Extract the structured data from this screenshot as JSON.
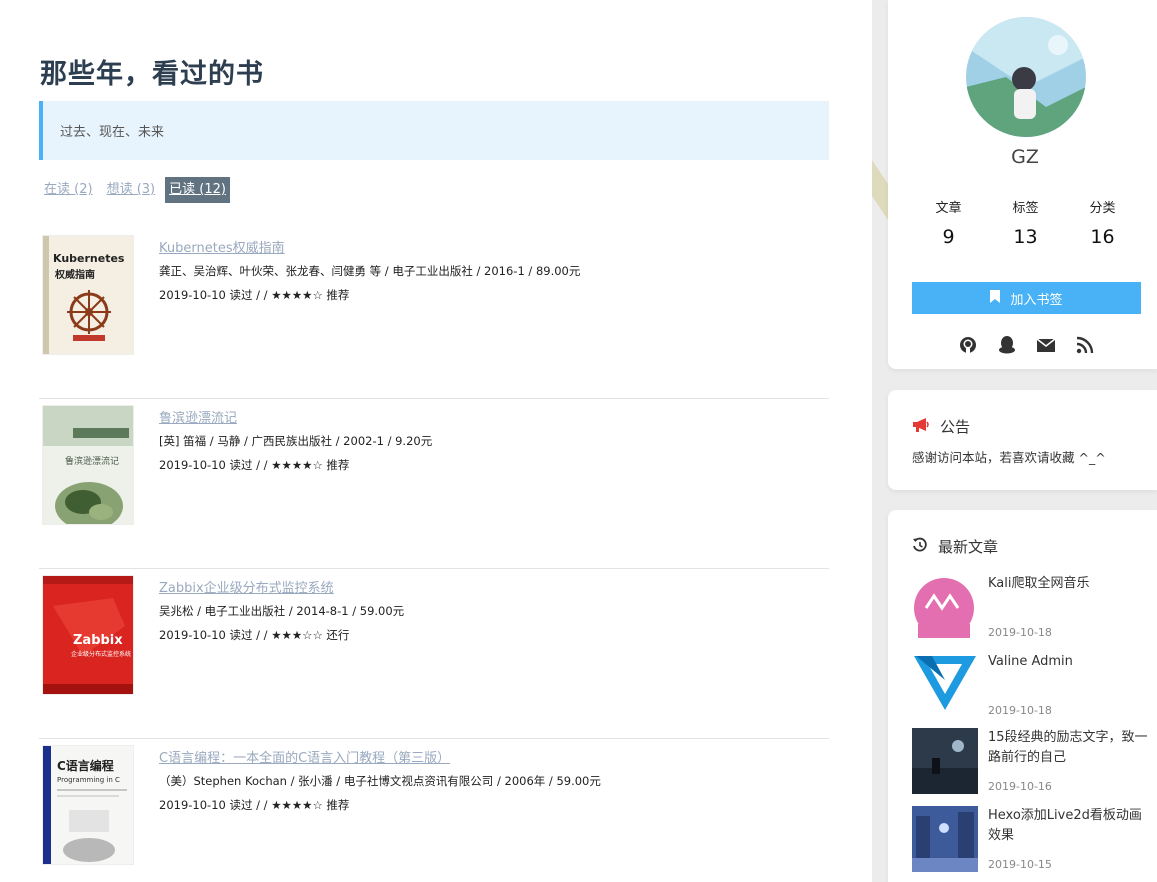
{
  "page": {
    "title": "那些年，看过的书",
    "quote": "过去、现在、未来"
  },
  "tabs": [
    {
      "label": "在读 (2)"
    },
    {
      "label": "想读 (3)"
    },
    {
      "label": "已读 (12)"
    }
  ],
  "books": [
    {
      "title": "Kubernetes权威指南",
      "meta": "龚正、吴治辉、叶伙荣、张龙春、闫健勇 等 / 电子工业出版社 / 2016-1 / 89.00元",
      "read": "2019-10-10 读过 / / ★★★★☆ 推荐",
      "cover_text": "Kubernetes",
      "cover_sub": "权威指南"
    },
    {
      "title": "鲁滨逊漂流记",
      "meta": "[英] 笛福 / 马静 / 广西民族出版社 / 2002-1 / 9.20元",
      "read": "2019-10-10 读过 / / ★★★★☆ 推荐",
      "cover_text": "鲁滨逊漂流记"
    },
    {
      "title": "Zabbix企业级分布式监控系统",
      "meta": "吴兆松 / 电子工业出版社 / 2014-8-1 / 59.00元",
      "read": "2019-10-10 读过 / / ★★★☆☆ 还行",
      "cover_text": "Zabbix",
      "cover_sub": "企业级分布式监控系统"
    },
    {
      "title": "C语言编程：一本全面的C语言入门教程（第三版）",
      "meta": "（美）Stephen Kochan / 张小潘 / 电子社博文视点资讯有限公司 / 2006年 / 59.00元",
      "read": "2019-10-10 读过 / / ★★★★☆ 推荐",
      "cover_text": "C语言编程",
      "cover_sub": "Programming in C"
    }
  ],
  "sidebar": {
    "author": "GZ",
    "stats": [
      {
        "label": "文章",
        "value": "9"
      },
      {
        "label": "标签",
        "value": "13"
      },
      {
        "label": "分类",
        "value": "16"
      }
    ],
    "bookmark_label": "加入书签",
    "social_icons": [
      "github-icon",
      "qq-icon",
      "email-icon",
      "rss-icon"
    ],
    "notice_title": "公告",
    "notice_text": "感谢访问本站，若喜欢请收藏 ^_^",
    "recent_title": "最新文章",
    "recent_posts": [
      {
        "title": "Kali爬取全网音乐",
        "date": "2019-10-18"
      },
      {
        "title": "Valine Admin",
        "date": "2019-10-18"
      },
      {
        "title": "15段经典的励志文字，致一路前行的自己",
        "date": "2019-10-16"
      },
      {
        "title": "Hexo添加Live2d看板动画效果",
        "date": "2019-10-15"
      }
    ]
  },
  "colors": {
    "accent": "#49b1f5",
    "title": "#2c3e50",
    "link": "#99a9bf",
    "active_tab": "#617380",
    "quote_bg": "#e8f4fd",
    "notice_icon": "#e53935"
  }
}
